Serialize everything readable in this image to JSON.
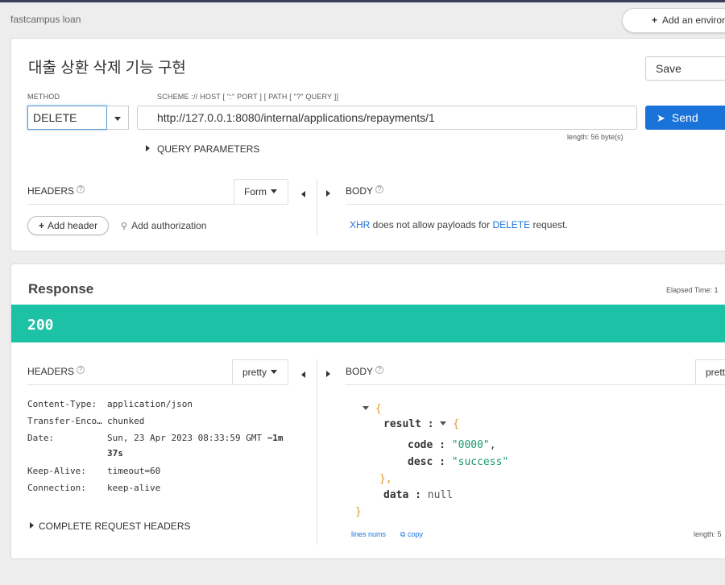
{
  "breadcrumb": "fastcampus loan",
  "env_button": "Add an environ",
  "request": {
    "title": "대출 상환 삭제 기능 구현",
    "save_label": "Save",
    "method_label": "METHOD",
    "method_value": "DELETE",
    "url_label": "SCHEME :// HOST [ \":\" PORT ] [ PATH [ \"?\" QUERY ]]",
    "url_value": "http://127.0.0.1:8080/internal/applications/repayments/1",
    "length_label": "length: 56 byte(s)",
    "send_label": "Send",
    "query_params_label": "QUERY PARAMETERS",
    "headers_label": "HEADERS",
    "form_label": "Form",
    "body_label": "BODY",
    "add_header_label": "Add header",
    "add_auth_label": "Add authorization",
    "xhr_text": {
      "xhr": "XHR",
      "mid": " does not allow payloads for ",
      "method": "DELETE",
      "end": " request."
    }
  },
  "response": {
    "title": "Response",
    "elapsed_label": "Elapsed Time: 1",
    "status_code": "200",
    "status_color": "#1dc2a6",
    "headers_label": "HEADERS",
    "pretty_label": "pretty",
    "body_label": "BODY",
    "body_pretty_label": "prett",
    "headers": [
      {
        "key": "Content-Type:",
        "value": "application/json"
      },
      {
        "key": "Transfer-Enco…",
        "value": "chunked"
      },
      {
        "key": "Date:",
        "value": "Sun, 23 Apr 2023 08:33:59 GMT",
        "extra1": "−1m",
        "extra2": "37s"
      },
      {
        "key": "Keep-Alive:",
        "value": "timeout=60"
      },
      {
        "key": "Connection:",
        "value": "keep-alive"
      }
    ],
    "complete_headers_label": "COMPLETE REQUEST HEADERS",
    "json": {
      "open": "{",
      "result_key": "result",
      "sep": ":",
      "result_open": "{",
      "code_key": "code",
      "code_val": "\"0000\"",
      "comma": ",",
      "desc_key": "desc",
      "desc_val": "\"success\"",
      "result_close": "},",
      "data_key": "data",
      "data_val": "null",
      "close": "}"
    },
    "lines_nums_label": "lines nums",
    "copy_label": "copy",
    "length_label": "length: 5"
  },
  "colors": {
    "accent": "#1a73d9",
    "success": "#1dc2a6"
  }
}
